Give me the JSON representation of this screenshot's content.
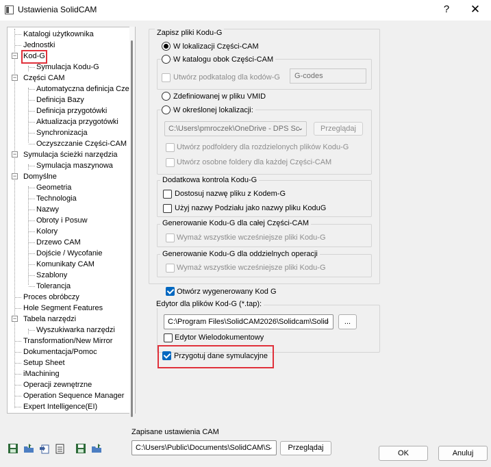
{
  "window": {
    "title": "Ustawienia SolidCAM",
    "help_label": "?",
    "close_label": "✕"
  },
  "tree": {
    "items": [
      {
        "label": "Katalogi użytkownika"
      },
      {
        "label": "Jednostki"
      },
      {
        "label": "Kod-G"
      },
      {
        "label": "Symulacja Kodu-G"
      },
      {
        "label": "Części CAM"
      },
      {
        "label": "Automatyczna definicja Cze"
      },
      {
        "label": "Definicja Bazy"
      },
      {
        "label": "Definicja przygotówki"
      },
      {
        "label": "Aktualizacja przygotówki"
      },
      {
        "label": "Synchronizacja"
      },
      {
        "label": "Oczyszczanie Części-CAM"
      },
      {
        "label": "Symulacja ścieżki narzędzia"
      },
      {
        "label": "Symulacja maszynowa"
      },
      {
        "label": "Domyślne"
      },
      {
        "label": "Geometria"
      },
      {
        "label": "Technologia"
      },
      {
        "label": "Nazwy"
      },
      {
        "label": "Obroty i Posuw"
      },
      {
        "label": "Kolory"
      },
      {
        "label": "Drzewo CAM"
      },
      {
        "label": "Dojście / Wycofanie"
      },
      {
        "label": "Komunikaty CAM"
      },
      {
        "label": "Szablony"
      },
      {
        "label": "Tolerancja"
      },
      {
        "label": "Proces obróbczy"
      },
      {
        "label": "Hole Segment Features"
      },
      {
        "label": "Tabela narzędzi"
      },
      {
        "label": "Wyszukiwarka narzędzi"
      },
      {
        "label": "Transformation/New Mirror"
      },
      {
        "label": "Dokumentacja/Pomoc"
      },
      {
        "label": "Setup Sheet"
      },
      {
        "label": "iMachining"
      },
      {
        "label": "Operacji zewnętrzne"
      },
      {
        "label": "Operation Sequence Manager"
      },
      {
        "label": "Expert Intelligence(EI)"
      }
    ]
  },
  "gcode": {
    "save_group_title": "Zapisz pliki Kodu-G",
    "opt_cam_part": "W lokalizacji Części-CAM",
    "opt_beside": "W katalogu obok Części-CAM",
    "create_subfolder": "Utwórz podkatalog dla kodów-G",
    "subfolder_value": "G-codes",
    "opt_vmid": "Zdefiniowanej w pliku VMID",
    "opt_specific": "W określonej lokalizacji:",
    "specific_path": "C:\\Users\\pmroczek\\OneDrive - DPS Sc",
    "browse": "Przeglądaj",
    "separate_folders": "Utwórz podfoldery dla rozdzielonych plików Kodu-G",
    "separate_each": "Utwórz osobne foldery dla każdej Części-CAM",
    "extra_title": "Dodatkowa kontrola Kodu-G",
    "adjust_name": "Dostosuj nazwę pliku z Kodem-G",
    "use_subdivision": "Użyj nazwy Podziału jako nazwy pliku KoduG",
    "whole_title": "Generowanie Kodu-G dla całej Części-CAM",
    "wipe_whole": "Wymaż wszystkie wcześniejsze pliki Kodu-G",
    "separate_title": "Generowanie Kodu-G dla oddzielnych operacji",
    "wipe_separate": "Wymaż wszystkie wcześniejsze pliki Kodu-G",
    "open_generated": "Otwórz wygenerowany Kod G",
    "editor_label": "Edytor dla plików Kod-G (*.tap):",
    "editor_path": "C:\\Program Files\\SolidCAM2026\\Solidcam\\Solid",
    "editor_more": "...",
    "multi_doc": "Edytor Wielodokumentowy",
    "prepare_sim": "Przygotuj dane symulacyjne"
  },
  "footer": {
    "saved_label": "Zapisane ustawienia CAM",
    "saved_path": "C:\\Users\\Public\\Documents\\SolidCAM\\S",
    "browse": "Przeglądaj",
    "ok": "OK",
    "cancel": "Anuluj"
  },
  "icons": [
    "save-icon",
    "open-icon",
    "import-icon",
    "export-icon",
    "save-default-icon",
    "load-icon"
  ]
}
